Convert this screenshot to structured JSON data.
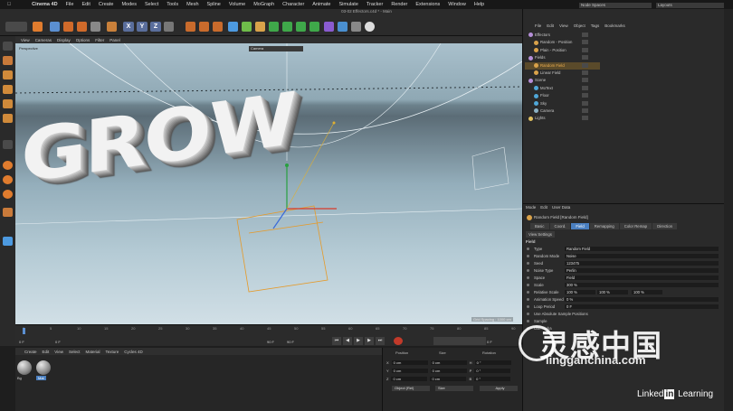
{
  "menubar": {
    "app": "Cinema 4D",
    "items": [
      "File",
      "Edit",
      "Create",
      "Modes",
      "Select",
      "Tools",
      "Mesh",
      "Spline",
      "Volume",
      "MoGraph",
      "Character",
      "Animate",
      "Simulate",
      "Tracker",
      "Render",
      "Extensions",
      "Window",
      "Help"
    ]
  },
  "window": {
    "title": "03-02 Effectors.c4d * - Main"
  },
  "toolbar": {
    "axis_labels": [
      "X",
      "Y",
      "Z"
    ]
  },
  "viewport": {
    "menu": [
      "View",
      "Cameras",
      "Display",
      "Options",
      "Filter",
      "Panel"
    ],
    "perspective": "Perspective",
    "camera": "Camera",
    "grid": "Grid Spacing : 1000 cm",
    "scene_text": "GROW"
  },
  "timeline": {
    "ticks": [
      "0",
      "5",
      "10",
      "15",
      "20",
      "25",
      "30",
      "35",
      "40",
      "45",
      "50",
      "55",
      "60",
      "65",
      "70",
      "75",
      "80",
      "85",
      "90"
    ],
    "frame_start": "0 F",
    "frame_cur": "0 F",
    "frame_end": "90 F",
    "frame_max": "90 F",
    "right_field": "0 F"
  },
  "materials": {
    "menu": [
      "Create",
      "Edit",
      "View",
      "Select",
      "Material",
      "Texture",
      "Cycles 4D"
    ],
    "items": [
      "Bg",
      "Mat"
    ]
  },
  "coords": {
    "headers": [
      "Position",
      "Size",
      "Rotation"
    ],
    "rows": [
      {
        "axis": "X",
        "pos": "0 cm",
        "size": "0 cm",
        "rlab": "H",
        "rot": "0 °"
      },
      {
        "axis": "Y",
        "pos": "0 cm",
        "size": "0 cm",
        "rlab": "P",
        "rot": "0 °"
      },
      {
        "axis": "Z",
        "pos": "0 cm",
        "size": "0 cm",
        "rlab": "B",
        "rot": "0 °"
      }
    ],
    "mode": "Object (Rel)",
    "sizemode": "Size",
    "apply": "Apply"
  },
  "objects": {
    "nodespaces": "Node Spaces",
    "layouts": "Layouts",
    "menu": [
      "File",
      "Edit",
      "View",
      "Object",
      "Tags",
      "Bookmarks"
    ],
    "items": [
      {
        "name": "Effectors",
        "color": "#b58fd8"
      },
      {
        "name": "Random - Position",
        "color": "#d9a24a"
      },
      {
        "name": "Plain - Position",
        "color": "#d9a24a"
      },
      {
        "name": "Fields",
        "color": "#b58fd8"
      },
      {
        "name": "Random Field",
        "color": "#d9a24a"
      },
      {
        "name": "Linear Field",
        "color": "#d9a24a"
      },
      {
        "name": "Scene",
        "color": "#b58fd8"
      },
      {
        "name": "MoText",
        "color": "#4fa7d8"
      },
      {
        "name": "Floor",
        "color": "#4fa7d8"
      },
      {
        "name": "Sky",
        "color": "#4fa7d8"
      },
      {
        "name": "Camera",
        "color": "#8ab0c4"
      },
      {
        "name": "Lights",
        "color": "#e0c060"
      }
    ]
  },
  "attributes": {
    "menu": [
      "Mode",
      "Edit",
      "User Data"
    ],
    "title": "Random Field [Random Field]",
    "tabs": [
      "Basic",
      "Coord.",
      "Field",
      "Remapping",
      "Color Remap",
      "Direction"
    ],
    "active_tab": "Field",
    "view_settings": "View Settings",
    "section": "Field",
    "rows": [
      {
        "label": "Type",
        "value": "Random Field"
      },
      {
        "label": "Random Mode",
        "value": "Noise"
      },
      {
        "label": "Seed",
        "value": "123475"
      },
      {
        "label": "Noise Type",
        "value": "Perlin"
      },
      {
        "label": "Space",
        "value": "Field"
      },
      {
        "label": "Scale",
        "value": "300 %"
      },
      {
        "label": "Relative Scale",
        "value": "100 %",
        "v2": "100 %",
        "v3": "100 %"
      },
      {
        "label": "Animation Speed",
        "value": "0 %"
      },
      {
        "label": "Loop Period",
        "value": "0 F"
      },
      {
        "label": "Use Absolute Sample Positions",
        "value": ""
      },
      {
        "label": "Sample",
        "value": ""
      },
      {
        "label": "Use Alpha",
        "value": ""
      }
    ]
  },
  "watermark": {
    "cn": "灵感中国",
    "url": "lingganchina.com",
    "brand1": "Linked",
    "brand2": "in",
    "brand3": "Learning"
  }
}
